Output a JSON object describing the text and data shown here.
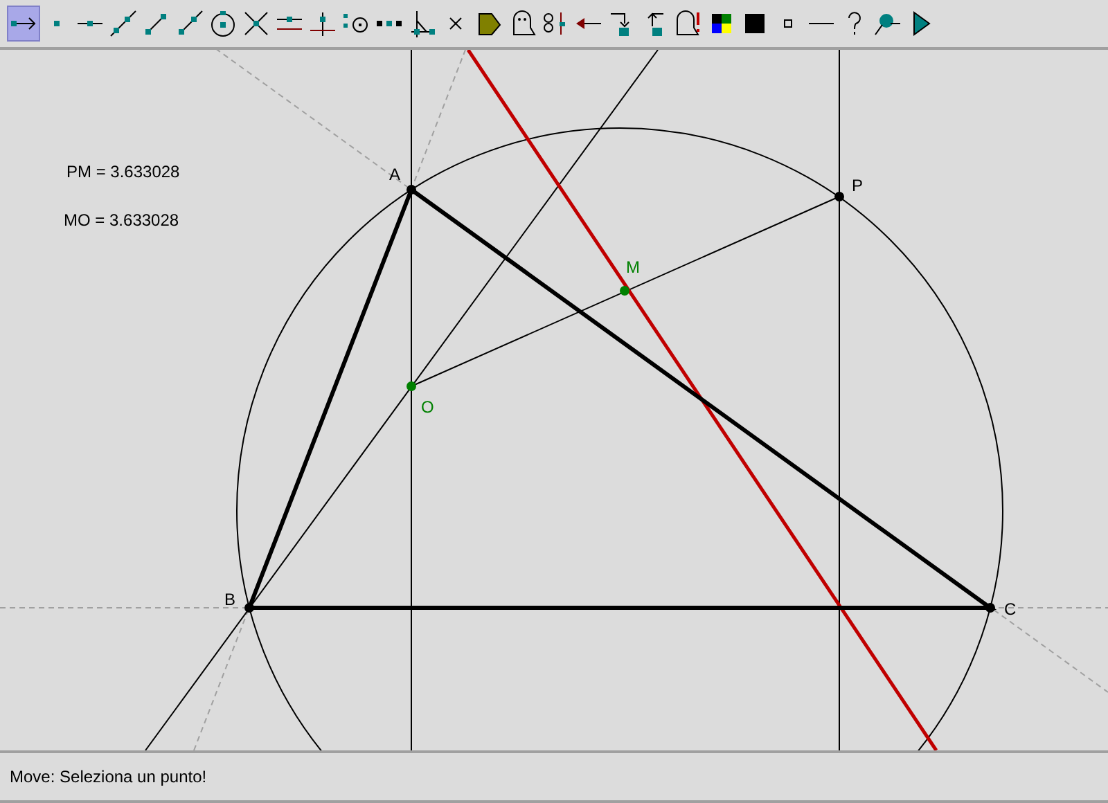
{
  "toolbar": [
    {
      "kind": "move",
      "selected": true
    },
    {
      "kind": "point",
      "selected": false
    },
    {
      "kind": "line-point",
      "selected": false
    },
    {
      "kind": "line",
      "selected": false
    },
    {
      "kind": "segment",
      "selected": false
    },
    {
      "kind": "ray",
      "selected": false
    },
    {
      "kind": "circle",
      "selected": false
    },
    {
      "kind": "intersect",
      "selected": false
    },
    {
      "kind": "parallel",
      "selected": false
    },
    {
      "kind": "perpendicular",
      "selected": false
    },
    {
      "kind": "dot-circle",
      "selected": false
    },
    {
      "kind": "dots",
      "selected": false
    },
    {
      "kind": "angle",
      "selected": false
    },
    {
      "kind": "cross",
      "selected": false
    },
    {
      "kind": "polygon",
      "selected": false
    },
    {
      "kind": "ghost",
      "selected": false
    },
    {
      "kind": "measure",
      "selected": false
    },
    {
      "kind": "back-arrow",
      "selected": false
    },
    {
      "kind": "macro-in",
      "selected": false
    },
    {
      "kind": "macro-out",
      "selected": false
    },
    {
      "kind": "ghost-alert",
      "selected": false
    },
    {
      "kind": "palette",
      "selected": false
    },
    {
      "kind": "filled-square",
      "selected": false
    },
    {
      "kind": "small-square",
      "selected": false
    },
    {
      "kind": "line-width",
      "selected": false
    },
    {
      "kind": "help",
      "selected": false
    },
    {
      "kind": "pin",
      "selected": false
    },
    {
      "kind": "play",
      "selected": false
    }
  ],
  "canvas": {
    "measurements": [
      "PM = 3.633028",
      "MO = 3.633028"
    ],
    "points": [
      {
        "label": "A",
        "color": "#000000"
      },
      {
        "label": "B",
        "color": "#000000"
      },
      {
        "label": "C",
        "color": "#000000"
      },
      {
        "label": "P",
        "color": "#000000"
      },
      {
        "label": "M",
        "color": "#008000"
      },
      {
        "label": "O",
        "color": "#008000"
      }
    ]
  },
  "status_bar": "Move: Seleziona un punto!"
}
